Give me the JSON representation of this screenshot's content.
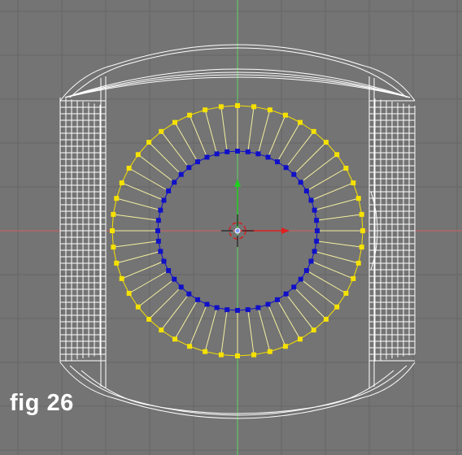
{
  "figure": {
    "label": "fig 26"
  },
  "viewport": {
    "background": "#747474",
    "grid_color": "#666666",
    "axis_x_color": "#d06060",
    "axis_y_color": "#5fd35f",
    "wire_color": "#ffffff",
    "outer_ring_color": "#f5e100",
    "inner_ring_color": "#1010c8",
    "edge_color": "#f5f0a0"
  },
  "mesh": {
    "ring_vertices": 48,
    "selected_outer_ring": true,
    "selected_inner_ring": true
  },
  "gizmo": {
    "x_arrow_color": "#e02020",
    "y_arrow_color": "#20d020",
    "cursor_color": "#d02020"
  }
}
